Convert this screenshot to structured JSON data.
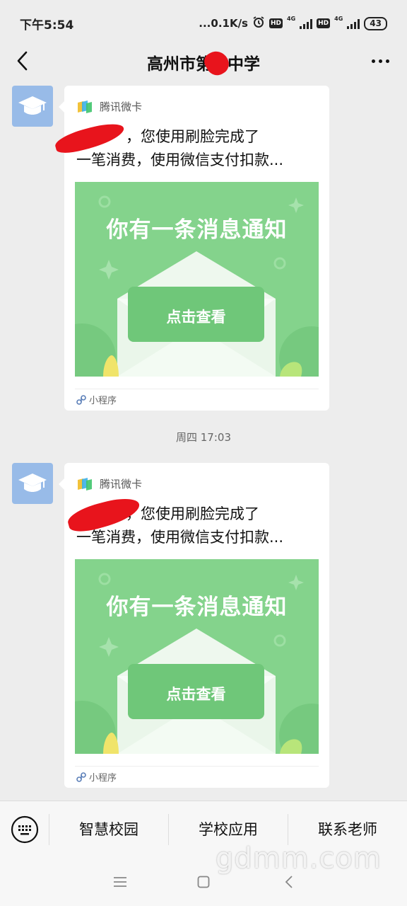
{
  "status_bar": {
    "time": "下午5:54",
    "network_speed": "...0.1K/s",
    "hd1": "HD",
    "net1": "4G",
    "hd2": "HD",
    "net2": "4G",
    "battery": "43"
  },
  "header": {
    "title_part1": "高州市第",
    "title_part2": "中学"
  },
  "messages": [
    {
      "source": "腾讯微卡",
      "line1": "您使用刷脸完成了",
      "line1_prefix": "，",
      "line2": "一笔消费，使用微信支付扣款...",
      "image_headline": "你有一条消息通知",
      "image_button": "点击查看",
      "footer": "小程序"
    },
    {
      "source": "腾讯微卡",
      "line1": "您使用刷脸完成了",
      "line1_prefix": "，",
      "line2": "一笔消费，使用微信支付扣款...",
      "image_headline": "你有一条消息通知",
      "image_button": "点击查看",
      "footer": "小程序"
    }
  ],
  "timestamp": "周四 17:03",
  "menu": {
    "items": [
      "智慧校园",
      "学校应用",
      "联系老师"
    ]
  },
  "watermark": "gdmm.com",
  "colors": {
    "accent_green": "#84d38c",
    "redaction": "#e8141c",
    "avatar_bg": "#98bbe8"
  }
}
